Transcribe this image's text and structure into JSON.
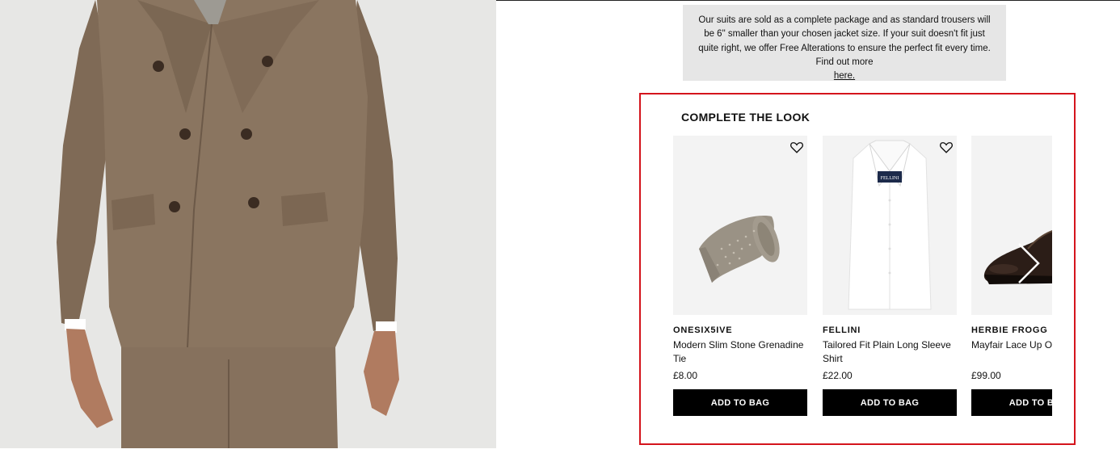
{
  "info": {
    "text": "Our suits are sold as a complete package and as standard trousers will be 6\" smaller than your chosen jacket size. If your suit doesn't fit just quite right, we offer Free Alterations to ensure the perfect fit every time. Find out more",
    "link_label": "here."
  },
  "complete_the_look": {
    "title": "COMPLETE THE LOOK",
    "products": [
      {
        "brand": "ONESIX5IVE",
        "name": "Modern Slim Stone Grenadine Tie",
        "price": "£8.00",
        "button": "ADD TO BAG",
        "image_icon": "tie-image"
      },
      {
        "brand": "FELLINI",
        "name": "Tailored Fit Plain Long Sleeve Shirt",
        "price": "£22.00",
        "button": "ADD TO BAG",
        "image_icon": "shirt-image",
        "shirt_label": "FELLINI"
      },
      {
        "brand": "HERBIE FROGG",
        "name": "Mayfair Lace Up Oxford",
        "price": "£99.00",
        "button": "ADD TO BAG",
        "image_icon": "shoe-image"
      }
    ],
    "next_icon": "chevron-right-icon",
    "wishlist_icon": "heart-icon"
  },
  "colors": {
    "highlight_border": "#d4141c",
    "button_bg": "#000000",
    "info_bg": "#e6e6e6",
    "suit": "#8a7560"
  }
}
